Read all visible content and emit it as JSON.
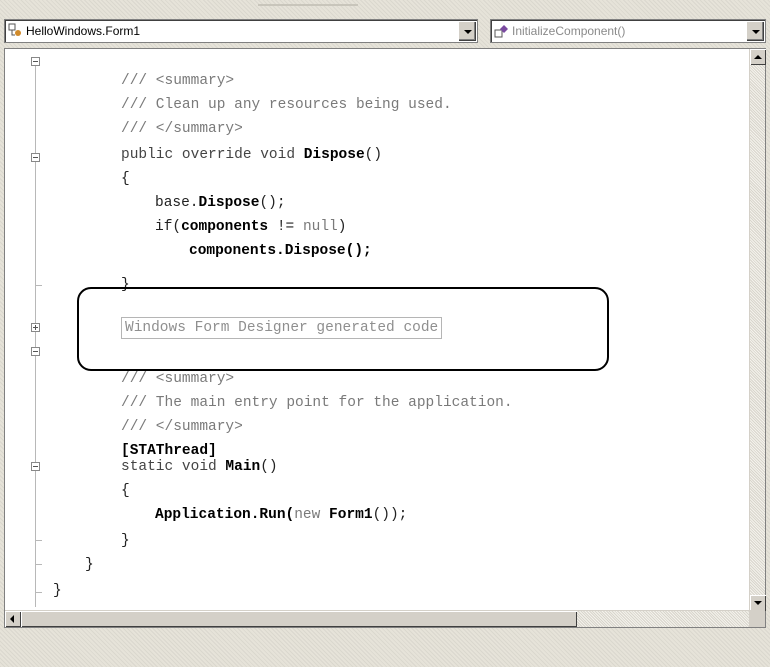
{
  "toolbar": {
    "class_selector": {
      "value": "HelloWindows.Form1",
      "icon": "class-icon"
    },
    "member_selector": {
      "value": "InitializeComponent()",
      "icon": "method-icon"
    }
  },
  "editor": {
    "lines": {
      "l1": "/// <summary>",
      "l2": "/// Clean up any resources being used.",
      "l3": "/// </summary>",
      "l4a": "public override void ",
      "l4b": "Dispose",
      "l4c": "()",
      "l5": "{",
      "l6a": "base.",
      "l6b": "Dispose",
      "l6c": "();",
      "l7a": "if(",
      "l7b": "components",
      "l7c": " != ",
      "l7d": "null",
      "l7e": ")",
      "l8": "components.Dispose();",
      "l9": "}",
      "region": "Windows Form Designer generated code",
      "l11": "/// <summary>",
      "l12": "/// The main entry point for the application.",
      "l13": "/// </summary>",
      "l14": "[STAThread]",
      "l15a": "static void ",
      "l15b": "Main",
      "l15c": "()",
      "l16": "{",
      "l17a": "Application.Run(",
      "l17b": "new ",
      "l17c": "Form1",
      "l17d": "());",
      "l18": "}",
      "l19": "}",
      "l20": "}"
    }
  }
}
